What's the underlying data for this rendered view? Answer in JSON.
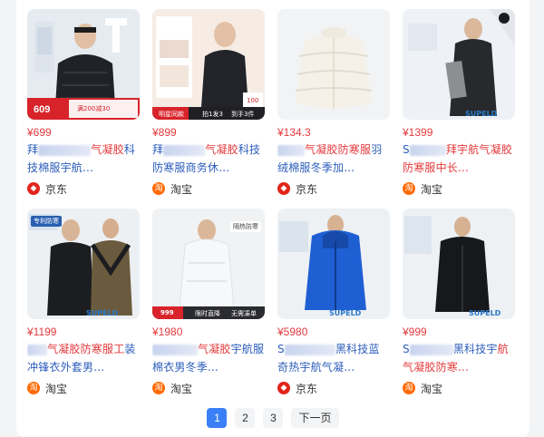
{
  "products": [
    {
      "price": "¥699",
      "title_pre": "拜",
      "title_hl": "气凝胶",
      "title_post": "科技棉服宇航...",
      "shop": "京东",
      "shop_type": "jd",
      "tag_price": "609",
      "tag_text": "满200减30"
    },
    {
      "price": "¥899",
      "title_pre": "拜",
      "title_hl": "气凝胶",
      "title_post": "科技防寒服商务休...",
      "shop": "淘宝",
      "shop_type": "tb",
      "tag_a": "拍1发3",
      "tag_b": "到手3件",
      "tag_c": "明星同款",
      "tag_price": "100"
    },
    {
      "price": "¥134.3",
      "title_pre": "",
      "title_hl": "气凝胶防寒服",
      "title_post": "羽绒棉服冬季加...",
      "shop": "京东",
      "shop_type": "jd"
    },
    {
      "price": "¥1399",
      "title_pre": "S",
      "title_hl": "",
      "title_mid": "拜宇航气凝胶防寒服中长...",
      "shop": "淘宝",
      "shop_type": "tb",
      "brand": "SUPELD"
    },
    {
      "price": "¥1199",
      "title_pre": "",
      "title_hl": "气凝胶防寒服工",
      "title_post": "装冲锋衣外套男...",
      "shop": "淘宝",
      "shop_type": "tb",
      "brand": "SUPELD",
      "badge": "专利防寒"
    },
    {
      "price": "¥1980",
      "title_pre": "",
      "title_hl": "气凝胶",
      "title_post": "宇航服棉衣男冬季...",
      "shop": "淘宝",
      "shop_type": "tb",
      "tag_price": "999",
      "tag_a": "限时直降",
      "tag_b": "无需凑单",
      "corner": "隔热防寒"
    },
    {
      "price": "¥5980",
      "title_pre": "S",
      "title_hl": "",
      "title_mid": "黑科技",
      "title_post": "蓝奇热宇航气凝...",
      "shop": "京东",
      "shop_type": "jd",
      "brand": "SUPELD"
    },
    {
      "price": "¥999",
      "title_pre": "S",
      "title_hl": "",
      "title_mid": "黑科技宇",
      "title_post": "航气凝胶防寒...",
      "shop": "淘宝",
      "shop_type": "tb",
      "brand": "SUPELD"
    }
  ],
  "pagination": {
    "pages": [
      "1",
      "2",
      "3"
    ],
    "active": "1",
    "next": "下一页"
  },
  "colors": {
    "price": "#e4393c",
    "title": "#2b5dbb",
    "active_page": "#3a7ff6"
  }
}
